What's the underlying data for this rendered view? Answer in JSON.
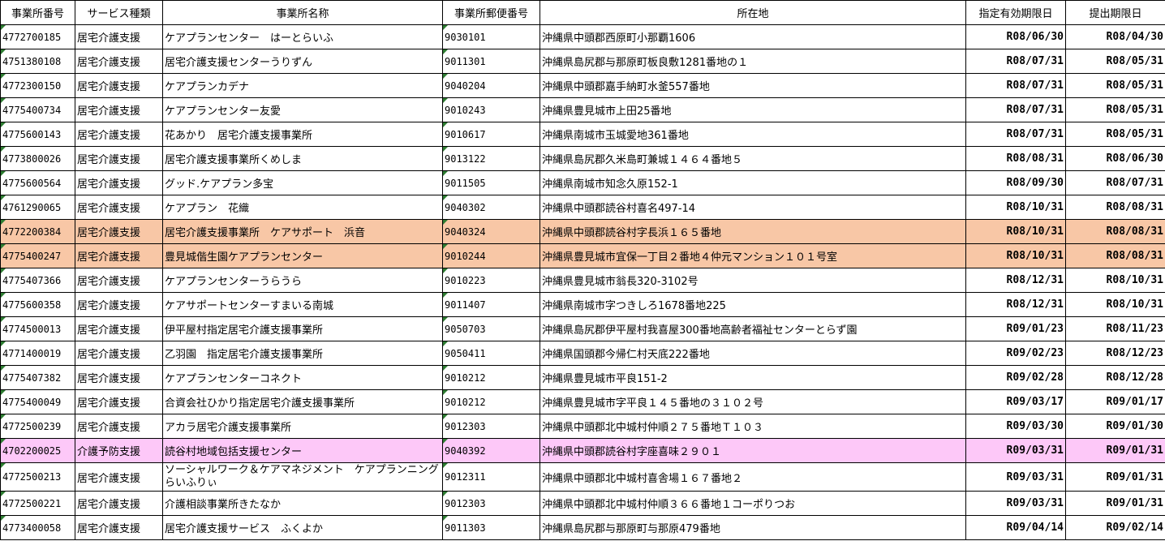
{
  "headers": [
    "事業所番号",
    "サービス種類",
    "事業所名称",
    "事業所郵便番号",
    "所在地",
    "指定有効期限日",
    "提出期限日"
  ],
  "rows": [
    {
      "id": "4772700185",
      "service": "居宅介護支援",
      "name": "ケアプランセンター　はーとらいふ",
      "zip": "9030101",
      "address": "沖縄県中頭郡西原町小那覇1606",
      "expiry": "R08/06/30",
      "deadline": "R08/04/30"
    },
    {
      "id": "4751380108",
      "service": "居宅介護支援",
      "name": "居宅介護支援センターうりずん",
      "zip": "9011301",
      "address": "沖縄県島尻郡与那原町板良敷1281番地の１",
      "expiry": "R08/07/31",
      "deadline": "R08/05/31"
    },
    {
      "id": "4772300150",
      "service": "居宅介護支援",
      "name": "ケアプランカデナ",
      "zip": "9040204",
      "address": "沖縄県中頭郡嘉手納町水釜557番地",
      "expiry": "R08/07/31",
      "deadline": "R08/05/31"
    },
    {
      "id": "4775400734",
      "service": "居宅介護支援",
      "name": "ケアプランセンター友愛",
      "zip": "9010243",
      "address": "沖縄県豊見城市上田25番地",
      "expiry": "R08/07/31",
      "deadline": "R08/05/31"
    },
    {
      "id": "4775600143",
      "service": "居宅介護支援",
      "name": "花あかり　居宅介護支援事業所",
      "zip": "9010617",
      "address": "沖縄県南城市玉城愛地361番地",
      "expiry": "R08/07/31",
      "deadline": "R08/05/31"
    },
    {
      "id": "4773800026",
      "service": "居宅介護支援",
      "name": "居宅介護支援事業所くめしま",
      "zip": "9013122",
      "address": "沖縄県島尻郡久米島町兼城１４６４番地５",
      "expiry": "R08/08/31",
      "deadline": "R08/06/30"
    },
    {
      "id": "4775600564",
      "service": "居宅介護支援",
      "name": "グッド.ケアプラン多宝",
      "zip": "9011505",
      "address": "沖縄県南城市知念久原152-1",
      "expiry": "R08/09/30",
      "deadline": "R08/07/31"
    },
    {
      "id": "4761290065",
      "service": "居宅介護支援",
      "name": "ケアプラン　花織",
      "zip": "9040302",
      "address": "沖縄県中頭郡読谷村喜名497-14",
      "expiry": "R08/10/31",
      "deadline": "R08/08/31"
    },
    {
      "id": "4772200384",
      "service": "居宅介護支援",
      "name": "居宅介護支援事業所　ケアサポート　浜音",
      "zip": "9040324",
      "address": "沖縄県中頭郡読谷村字長浜１６５番地",
      "expiry": "R08/10/31",
      "deadline": "R08/08/31",
      "highlight": "orange"
    },
    {
      "id": "4775400247",
      "service": "居宅介護支援",
      "name": "豊見城偕生園ケアプランセンター",
      "zip": "9010244",
      "address": "沖縄県豊見城市宜保一丁目２番地４仲元マンション１０１号室",
      "expiry": "R08/10/31",
      "deadline": "R08/08/31",
      "highlight": "orange"
    },
    {
      "id": "4775407366",
      "service": "居宅介護支援",
      "name": "ケアプランセンターうらうら",
      "zip": "9010223",
      "address": "沖縄県豊見城市翁長320-3102号",
      "expiry": "R08/12/31",
      "deadline": "R08/10/31"
    },
    {
      "id": "4775600358",
      "service": "居宅介護支援",
      "name": "ケアサポートセンターすまいる南城",
      "zip": "9011407",
      "address": "沖縄県南城市字つきしろ1678番地225",
      "expiry": "R08/12/31",
      "deadline": "R08/10/31"
    },
    {
      "id": "4774500013",
      "service": "居宅介護支援",
      "name": "伊平屋村指定居宅介護支援事業所",
      "zip": "9050703",
      "address": "沖縄県島尻郡伊平屋村我喜屋300番地高齢者福祉センターとらず園",
      "expiry": "R09/01/23",
      "deadline": "R08/11/23"
    },
    {
      "id": "4771400019",
      "service": "居宅介護支援",
      "name": "乙羽園　指定居宅介護支援事業所",
      "zip": "9050411",
      "address": "沖縄県国頭郡今帰仁村天底222番地",
      "expiry": "R09/02/23",
      "deadline": "R08/12/23"
    },
    {
      "id": "4775407382",
      "service": "居宅介護支援",
      "name": "ケアプランセンターコネクト",
      "zip": "9010212",
      "address": "沖縄県豊見城市平良151-2",
      "expiry": "R09/02/28",
      "deadline": "R08/12/28"
    },
    {
      "id": "4775400049",
      "service": "居宅介護支援",
      "name": "合資会社ひかり指定居宅介護支援事業所",
      "zip": "9010212",
      "address": "沖縄県豊見城市字平良１４５番地の３１０２号",
      "expiry": "R09/03/17",
      "deadline": "R09/01/17"
    },
    {
      "id": "4772500239",
      "service": "居宅介護支援",
      "name": "アカラ居宅介護支援事業所",
      "zip": "9012303",
      "address": "沖縄県中頭郡北中城村仲順２７５番地Ｔ１０３",
      "expiry": "R09/03/30",
      "deadline": "R09/01/30"
    },
    {
      "id": "4702200025",
      "service": "介護予防支援",
      "name": "読谷村地域包括支援センター",
      "zip": "9040392",
      "address": "沖縄県中頭郡読谷村字座喜味２９０１",
      "expiry": "R09/03/31",
      "deadline": "R09/01/31",
      "highlight": "pink"
    },
    {
      "id": "4772500213",
      "service": "居宅介護支援",
      "name": "ソーシャルワーク＆ケアマネジメント　ケアプランニング　らいふりぃ",
      "zip": "9012311",
      "address": "沖縄県中頭郡北中城村喜舎場１６７番地２",
      "expiry": "R09/03/31",
      "deadline": "R09/01/31",
      "wrap": true
    },
    {
      "id": "4772500221",
      "service": "居宅介護支援",
      "name": "介護相談事業所きたなか",
      "zip": "9012303",
      "address": "沖縄県中頭郡北中城村仲順３６６番地１コーポりつお",
      "expiry": "R09/03/31",
      "deadline": "R09/01/31"
    },
    {
      "id": "4773400058",
      "service": "居宅介護支援",
      "name": "居宅介護支援サービス　ふくよか",
      "zip": "9011303",
      "address": "沖縄県島尻郡与那原町与那原479番地",
      "expiry": "R09/04/14",
      "deadline": "R09/02/14"
    }
  ]
}
